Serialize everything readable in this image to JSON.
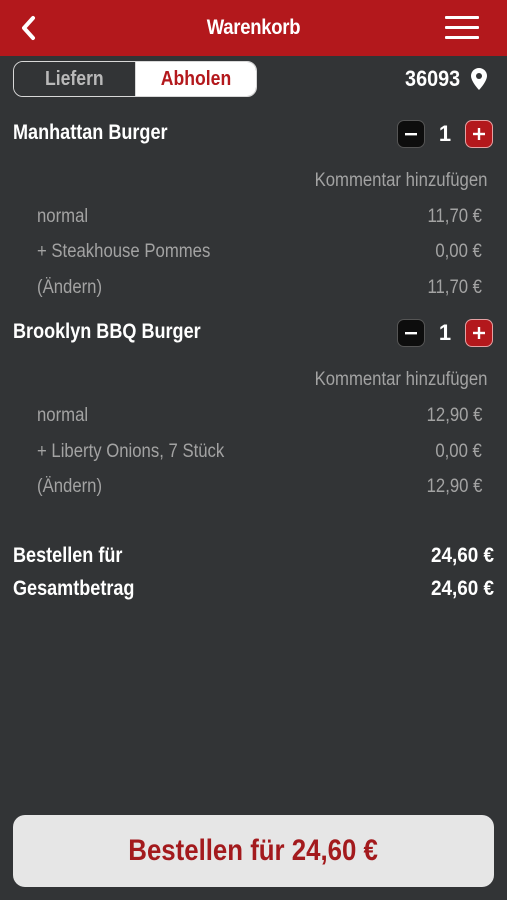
{
  "header": {
    "title": "Warenkorb"
  },
  "mode_toggle": {
    "deliver_label": "Liefern",
    "pickup_label": "Abholen",
    "selected": "Abholen"
  },
  "location": {
    "zip": "36093"
  },
  "cart": {
    "items": [
      {
        "name": "Manhattan Burger",
        "quantity": "1",
        "comment_label": "Kommentar hinzufügen",
        "lines": [
          {
            "label": "normal",
            "price": "11,70 €"
          },
          {
            "label": "+ Steakhouse Pommes",
            "price": "0,00 €"
          },
          {
            "label": "(Ändern)",
            "price": "11,70 €"
          }
        ]
      },
      {
        "name": "Brooklyn BBQ Burger",
        "quantity": "1",
        "comment_label": "Kommentar hinzufügen",
        "lines": [
          {
            "label": "normal",
            "price": "12,90 €"
          },
          {
            "label": "+ Liberty Onions, 7 Stück",
            "price": "0,00 €"
          },
          {
            "label": "(Ändern)",
            "price": "12,90 €"
          }
        ]
      }
    ]
  },
  "totals": {
    "order_for_label": "Bestellen für",
    "order_for_value": "24,60 €",
    "total_label": "Gesamtbetrag",
    "total_value": "24,60 €"
  },
  "order_button": {
    "label": "Bestellen für 24,60 €"
  },
  "colors": {
    "brand_red": "#b3181c",
    "background": "#323436",
    "muted_text": "#a3a3a3"
  },
  "icons": {
    "back": "chevron-left-icon",
    "menu": "hamburger-menu-icon",
    "location": "map-pin-icon",
    "minus": "minus-icon",
    "plus": "plus-icon"
  }
}
